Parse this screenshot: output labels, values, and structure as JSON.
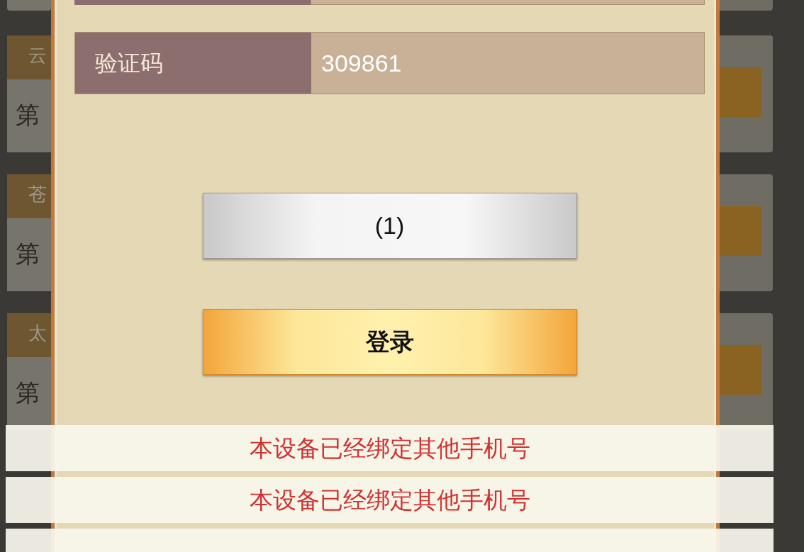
{
  "background_cards": [
    {
      "title": "云",
      "subtitle": "第"
    },
    {
      "title": "苍",
      "subtitle": "第"
    },
    {
      "title": "太",
      "subtitle": "第"
    }
  ],
  "form": {
    "fields": [
      {
        "label": "验证码",
        "value": "309861"
      }
    ]
  },
  "buttons": [
    {
      "label": "(1)",
      "kind": "secondary"
    },
    {
      "label": "登录",
      "kind": "primary"
    }
  ],
  "toasts": [
    "本设备已经绑定其他手机号",
    "本设备已经绑定其他手机号"
  ]
}
